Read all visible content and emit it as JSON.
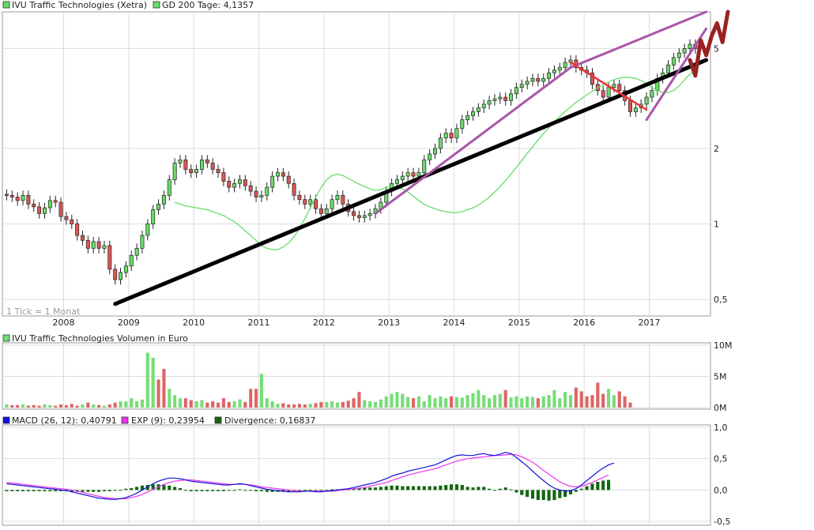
{
  "legend": {
    "price_label": "IVU Traffic Technologies (Xetra)",
    "gd_label": "GD 200 Tage: 4,1357",
    "volume_label": "IVU Traffic Technologies Volumen in Euro",
    "macd_label": "MACD (26, 12): 0,40791",
    "exp_label": "EXP (9): 0,23954",
    "div_label": "Divergence: 0,16837",
    "tick_note": "1 Tick = 1 Monat"
  },
  "colors": {
    "up": "#66dd66",
    "down": "#dd5555",
    "gd": "#66dd66",
    "black_trend": "#000000",
    "purple_trend": "#aa55aa",
    "red_trend": "#ee3333",
    "projection": "#992222",
    "macd": "#1111dd",
    "exp": "#ee33ee",
    "divergence": "#116611",
    "vol_up": "#77dd77",
    "vol_down": "#dd6666"
  },
  "chart_data": [
    {
      "type": "candlestick",
      "name": "price",
      "title": "IVU Traffic Technologies (Xetra)",
      "y_scale": "log",
      "ylim": [
        0.43,
        7.0
      ],
      "y_ticks": [
        "0,5",
        "1",
        "2",
        "5"
      ],
      "y_tick_values": [
        0.5,
        1,
        2,
        5
      ],
      "x_ticks": [
        "2008",
        "2009",
        "2010",
        "2011",
        "2012",
        "2013",
        "2014",
        "2015",
        "2016",
        "2017"
      ],
      "x_tick_values": [
        "2008-01",
        "2009-01",
        "2010-01",
        "2011-01",
        "2012-01",
        "2013-01",
        "2014-01",
        "2015-01",
        "2016-01",
        "2017-01"
      ],
      "x_range": [
        "2007-02",
        "2017-11"
      ],
      "close": [
        1.3,
        1.28,
        1.24,
        1.3,
        1.2,
        1.17,
        1.1,
        1.16,
        1.24,
        1.22,
        1.07,
        1.04,
        1.0,
        0.9,
        0.86,
        0.8,
        0.85,
        0.8,
        0.82,
        0.66,
        0.6,
        0.64,
        0.68,
        0.75,
        0.8,
        0.9,
        1.0,
        1.14,
        1.2,
        1.3,
        1.5,
        1.75,
        1.8,
        1.65,
        1.6,
        1.65,
        1.8,
        1.75,
        1.65,
        1.6,
        1.48,
        1.4,
        1.45,
        1.5,
        1.42,
        1.35,
        1.28,
        1.3,
        1.4,
        1.55,
        1.6,
        1.55,
        1.45,
        1.3,
        1.25,
        1.2,
        1.25,
        1.15,
        1.1,
        1.15,
        1.25,
        1.3,
        1.2,
        1.12,
        1.08,
        1.06,
        1.08,
        1.1,
        1.15,
        1.22,
        1.35,
        1.45,
        1.5,
        1.55,
        1.6,
        1.55,
        1.6,
        1.8,
        1.9,
        2.0,
        2.2,
        2.3,
        2.2,
        2.4,
        2.6,
        2.7,
        2.8,
        2.9,
        3.0,
        3.1,
        3.15,
        3.2,
        3.1,
        3.3,
        3.5,
        3.6,
        3.7,
        3.8,
        3.7,
        3.8,
        4.0,
        4.1,
        4.2,
        4.4,
        4.5,
        4.2,
        4.1,
        4.0,
        3.6,
        3.4,
        3.2,
        3.5,
        3.6,
        3.4,
        3.1,
        2.8,
        2.9,
        3.0,
        3.2,
        3.4,
        3.8,
        4.0,
        4.3,
        4.6,
        4.8,
        5.0,
        5.2,
        5.0
      ],
      "gd200": [
        1.22,
        1.2,
        1.18,
        1.17,
        1.16,
        1.15,
        1.14,
        1.12,
        1.1,
        1.08,
        1.05,
        1.02,
        0.98,
        0.94,
        0.9,
        0.86,
        0.82,
        0.8,
        0.79,
        0.79,
        0.81,
        0.84,
        0.89,
        0.96,
        1.05,
        1.16,
        1.28,
        1.4,
        1.5,
        1.56,
        1.58,
        1.56,
        1.52,
        1.48,
        1.44,
        1.41,
        1.38,
        1.36,
        1.37,
        1.4,
        1.41,
        1.4,
        1.38,
        1.34,
        1.29,
        1.24,
        1.2,
        1.17,
        1.15,
        1.13,
        1.12,
        1.11,
        1.11,
        1.12,
        1.14,
        1.16,
        1.19,
        1.23,
        1.28,
        1.34,
        1.41,
        1.49,
        1.58,
        1.68,
        1.79,
        1.91,
        2.03,
        2.16,
        2.29,
        2.42,
        2.55,
        2.68,
        2.81,
        2.93,
        3.05,
        3.16,
        3.27,
        3.38,
        3.49,
        3.59,
        3.68,
        3.76,
        3.82,
        3.84,
        3.83,
        3.8,
        3.73,
        3.62,
        3.5,
        3.4,
        3.34,
        3.34,
        3.4,
        3.55,
        3.75,
        3.95,
        4.14
      ]
    },
    {
      "type": "line",
      "name": "trendlines",
      "series": [
        {
          "name": "black",
          "x": [
            "2008-10",
            "2017-11"
          ],
          "y": [
            0.48,
            4.5
          ]
        },
        {
          "name": "purple-lower",
          "x": [
            "2012-10",
            "2015-10"
          ],
          "y": [
            1.1,
            4.2
          ]
        },
        {
          "name": "purple-upper",
          "x": [
            "2015-10",
            "2017-11"
          ],
          "y": [
            4.2,
            7.0
          ]
        },
        {
          "name": "purple-channel",
          "x": [
            "2016-12",
            "2017-11"
          ],
          "y": [
            2.6,
            6.0
          ]
        },
        {
          "name": "red",
          "x": [
            "2015-10",
            "2016-12"
          ],
          "y": [
            4.4,
            2.85
          ]
        },
        {
          "name": "projection",
          "x": [
            "2017-08",
            "2017-09",
            "2017-10",
            "2017-11",
            "2017-12",
            "2018-01",
            "2018-02",
            "2018-03"
          ],
          "y": [
            4.5,
            3.9,
            5.4,
            4.7,
            5.6,
            6.3,
            5.3,
            7.0
          ]
        }
      ]
    },
    {
      "type": "bar",
      "name": "volume",
      "title": "IVU Traffic Technologies Volumen in Euro",
      "ylim": [
        0,
        10
      ],
      "y_ticks": [
        "0M",
        "5M",
        "10M"
      ],
      "y_tick_values": [
        0,
        5,
        10
      ],
      "values": [
        0.5,
        0.4,
        0.4,
        0.5,
        0.3,
        0.4,
        0.3,
        0.5,
        0.4,
        0.3,
        0.5,
        0.4,
        0.6,
        0.3,
        0.5,
        0.8,
        0.5,
        0.4,
        0.3,
        0.5,
        0.8,
        1.0,
        1.0,
        1.5,
        1.0,
        1.3,
        8.8,
        8.0,
        4.5,
        6.2,
        3.0,
        2.0,
        1.5,
        1.5,
        1.2,
        1.0,
        1.2,
        0.8,
        1.0,
        0.8,
        1.5,
        0.9,
        1.0,
        1.3,
        0.9,
        3.0,
        3.0,
        5.4,
        1.5,
        1.0,
        0.6,
        0.7,
        0.5,
        0.5,
        0.6,
        0.5,
        0.6,
        0.7,
        0.9,
        0.9,
        1.0,
        0.8,
        0.9,
        1.1,
        1.5,
        2.5,
        1.2,
        1.0,
        0.9,
        1.3,
        1.8,
        2.2,
        2.5,
        2.2,
        1.7,
        1.5,
        1.8,
        1.0,
        2.0,
        1.5,
        1.8,
        1.5,
        1.8,
        1.7,
        1.6,
        2.0,
        2.3,
        2.8,
        2.0,
        1.5,
        2.0,
        2.2,
        2.8,
        1.6,
        1.8,
        1.5,
        1.8,
        1.7,
        1.5,
        1.8,
        2.0,
        2.8,
        1.5,
        2.5,
        2.0,
        3.2,
        2.6,
        1.8,
        2.0,
        4.0,
        2.2,
        3.0,
        2.0,
        2.6,
        1.8,
        0.8
      ],
      "up": [
        1,
        0,
        0,
        1,
        0,
        0,
        0,
        1,
        1,
        0,
        0,
        0,
        0,
        0,
        1,
        0,
        1,
        0,
        1,
        0,
        0,
        1,
        1,
        1,
        1,
        1,
        1,
        1,
        0,
        0,
        1,
        1,
        1,
        0,
        0,
        1,
        1,
        0,
        0,
        0,
        0,
        0,
        1,
        1,
        0,
        0,
        0,
        1,
        1,
        1,
        1,
        0,
        0,
        0,
        0,
        0,
        1,
        0,
        0,
        1,
        1,
        1,
        0,
        0,
        0,
        0,
        1,
        1,
        1,
        1,
        1,
        1,
        1,
        1,
        1,
        0,
        1,
        1,
        1,
        1,
        1,
        1,
        0,
        1,
        1,
        1,
        1,
        1,
        1,
        1,
        1,
        1,
        0,
        1,
        1,
        1,
        1,
        1,
        0,
        1,
        1,
        1,
        1,
        1,
        1,
        0,
        0,
        0,
        0,
        0,
        0,
        1,
        1,
        0,
        0,
        0,
        1,
        1,
        1,
        1,
        1,
        1,
        1,
        1,
        1,
        1,
        1,
        0
      ]
    },
    {
      "type": "line",
      "name": "macd",
      "ylim": [
        -0.5,
        1.0
      ],
      "y_ticks": [
        "-0,5",
        "0,0",
        "0,5",
        "1,0"
      ],
      "y_tick_values": [
        -0.5,
        0,
        0.5,
        1.0
      ],
      "series": [
        {
          "name": "MACD (26, 12): 0,40791",
          "values": [
            0.1,
            0.09,
            0.08,
            0.07,
            0.06,
            0.05,
            0.04,
            0.03,
            0.02,
            0.01,
            0.0,
            -0.01,
            -0.03,
            -0.05,
            -0.07,
            -0.09,
            -0.11,
            -0.13,
            -0.14,
            -0.15,
            -0.15,
            -0.14,
            -0.12,
            -0.09,
            -0.05,
            0.0,
            0.05,
            0.1,
            0.14,
            0.17,
            0.19,
            0.19,
            0.18,
            0.16,
            0.14,
            0.13,
            0.12,
            0.11,
            0.1,
            0.09,
            0.08,
            0.08,
            0.09,
            0.1,
            0.09,
            0.07,
            0.05,
            0.03,
            0.01,
            0.0,
            -0.01,
            -0.02,
            -0.03,
            -0.03,
            -0.03,
            -0.02,
            -0.02,
            -0.03,
            -0.03,
            -0.02,
            -0.01,
            0.0,
            0.01,
            0.02,
            0.04,
            0.06,
            0.08,
            0.1,
            0.12,
            0.15,
            0.18,
            0.22,
            0.25,
            0.27,
            0.3,
            0.32,
            0.34,
            0.36,
            0.38,
            0.4,
            0.44,
            0.48,
            0.52,
            0.55,
            0.56,
            0.55,
            0.55,
            0.57,
            0.58,
            0.56,
            0.55,
            0.57,
            0.6,
            0.58,
            0.52,
            0.45,
            0.38,
            0.3,
            0.22,
            0.15,
            0.08,
            0.03,
            0.0,
            -0.02,
            -0.01,
            0.02,
            0.08,
            0.15,
            0.22,
            0.29,
            0.35,
            0.4,
            0.43
          ]
        },
        {
          "name": "EXP (9): 0,23954",
          "values": [
            0.12,
            0.11,
            0.1,
            0.09,
            0.08,
            0.07,
            0.06,
            0.05,
            0.04,
            0.03,
            0.02,
            0.01,
            0.0,
            -0.02,
            -0.04,
            -0.06,
            -0.08,
            -0.1,
            -0.12,
            -0.13,
            -0.14,
            -0.14,
            -0.14,
            -0.12,
            -0.1,
            -0.07,
            -0.03,
            0.01,
            0.05,
            0.09,
            0.12,
            0.14,
            0.15,
            0.16,
            0.16,
            0.15,
            0.14,
            0.13,
            0.12,
            0.11,
            0.1,
            0.09,
            0.09,
            0.09,
            0.09,
            0.08,
            0.07,
            0.05,
            0.04,
            0.03,
            0.02,
            0.01,
            0.0,
            -0.01,
            -0.02,
            -0.02,
            -0.02,
            -0.02,
            -0.02,
            -0.02,
            -0.02,
            -0.01,
            0.0,
            0.01,
            0.02,
            0.03,
            0.04,
            0.06,
            0.08,
            0.1,
            0.12,
            0.15,
            0.18,
            0.21,
            0.24,
            0.26,
            0.28,
            0.3,
            0.32,
            0.34,
            0.37,
            0.4,
            0.43,
            0.46,
            0.48,
            0.5,
            0.51,
            0.52,
            0.53,
            0.54,
            0.55,
            0.55,
            0.56,
            0.57,
            0.56,
            0.53,
            0.49,
            0.44,
            0.38,
            0.31,
            0.25,
            0.19,
            0.13,
            0.09,
            0.06,
            0.05,
            0.06,
            0.09,
            0.12,
            0.16,
            0.2,
            0.24
          ]
        }
      ]
    }
  ]
}
